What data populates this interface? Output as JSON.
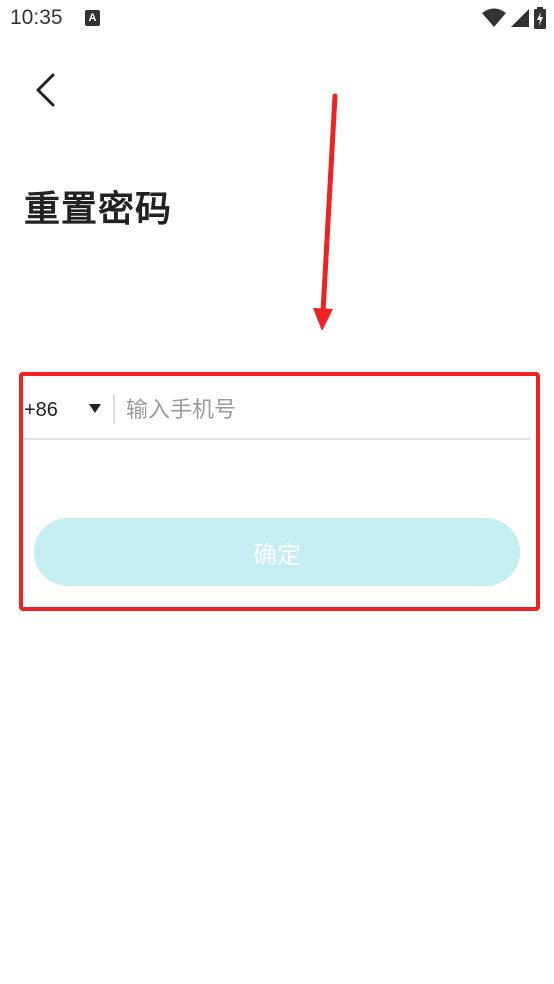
{
  "status_bar": {
    "time": "10:35",
    "notification_glyph": "A",
    "icons": [
      "wifi-icon",
      "signal-icon",
      "battery-charging-icon"
    ]
  },
  "header": {
    "back_icon": "chevron-left-icon",
    "title": "重置密码"
  },
  "form": {
    "country_code": "+86",
    "country_code_icon": "dropdown-arrow-icon",
    "phone_placeholder": "输入手机号",
    "phone_value": "",
    "confirm_label": "确定"
  },
  "colors": {
    "confirm_button_bg": "#c5eef2",
    "annotation_red": "#ee2222",
    "placeholder_gray": "#9a9a9a"
  }
}
